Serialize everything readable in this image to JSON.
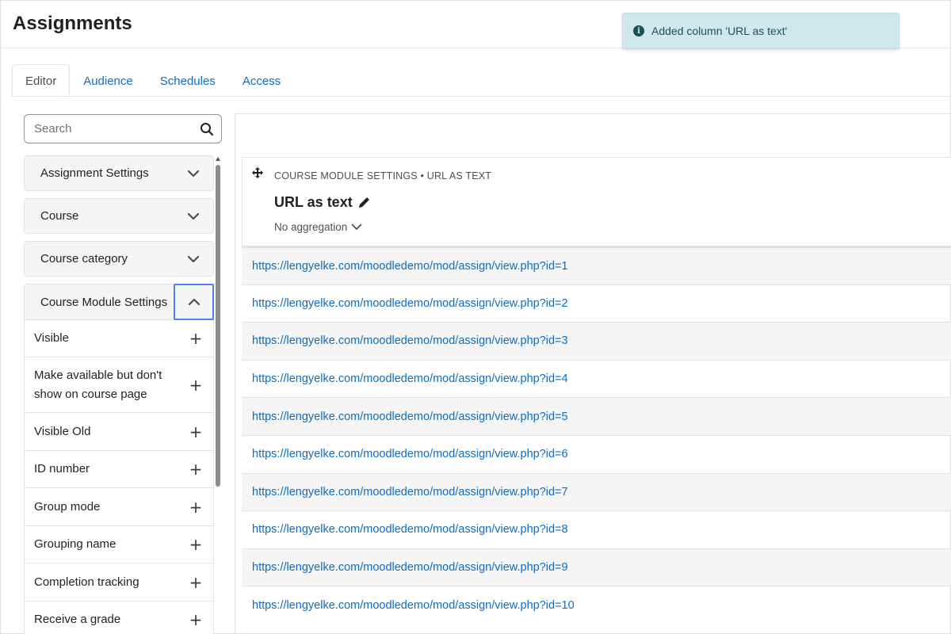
{
  "page": {
    "title": "Assignments"
  },
  "toast": {
    "message": "Added column 'URL as text'"
  },
  "tabs": [
    {
      "label": "Editor",
      "active": true
    },
    {
      "label": "Audience",
      "active": false
    },
    {
      "label": "Schedules",
      "active": false
    },
    {
      "label": "Access",
      "active": false
    }
  ],
  "search": {
    "placeholder": "Search",
    "value": ""
  },
  "sidebar": {
    "sections": [
      {
        "label": "Assignment Settings",
        "expanded": false
      },
      {
        "label": "Course",
        "expanded": false
      },
      {
        "label": "Course category",
        "expanded": false
      }
    ],
    "open_section": {
      "label": "Course Module Settings",
      "expanded": true,
      "fields": [
        {
          "label": "Visible"
        },
        {
          "label": "Make available but don't show on course page"
        },
        {
          "label": "Visible Old"
        },
        {
          "label": "ID number"
        },
        {
          "label": "Group mode"
        },
        {
          "label": "Grouping name"
        },
        {
          "label": "Completion tracking"
        },
        {
          "label": "Receive a grade"
        }
      ]
    }
  },
  "column_card": {
    "breadcrumb": "COURSE MODULE SETTINGS • URL AS TEXT",
    "title": "URL as text",
    "aggregation": "No aggregation"
  },
  "rows": [
    "https://lengyelke.com/moodledemo/mod/assign/view.php?id=1",
    "https://lengyelke.com/moodledemo/mod/assign/view.php?id=2",
    "https://lengyelke.com/moodledemo/mod/assign/view.php?id=3",
    "https://lengyelke.com/moodledemo/mod/assign/view.php?id=4",
    "https://lengyelke.com/moodledemo/mod/assign/view.php?id=5",
    "https://lengyelke.com/moodledemo/mod/assign/view.php?id=6",
    "https://lengyelke.com/moodledemo/mod/assign/view.php?id=7",
    "https://lengyelke.com/moodledemo/mod/assign/view.php?id=8",
    "https://lengyelke.com/moodledemo/mod/assign/view.php?id=9",
    "https://lengyelke.com/moodledemo/mod/assign/view.php?id=10"
  ],
  "colors": {
    "link": "#0f6cbf",
    "toast_bg": "#cfe8ec",
    "focus_ring": "#4d7ef7"
  }
}
